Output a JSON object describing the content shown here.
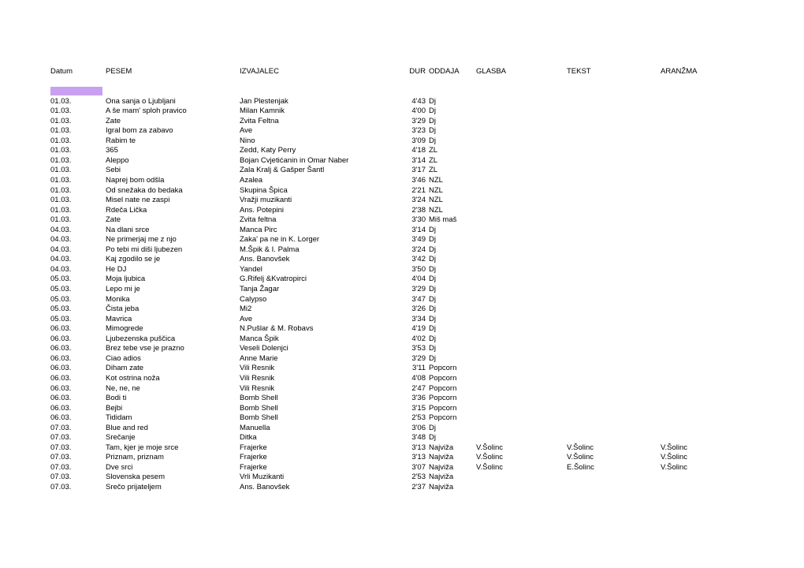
{
  "document": {
    "type": "spreadsheet-playlist-log",
    "highlight_color": "#c9a0f0"
  },
  "table": {
    "headers": {
      "datum": "Datum",
      "pesem": "PESEM",
      "izvajalec": "IZVAJALEC",
      "dur": "DUR",
      "oddaja": "ODDAJA",
      "glasba": "GLASBA",
      "tekst": "TEKST",
      "aranzma": "ARANŽMA"
    },
    "rows": [
      {
        "datum": "01.03.",
        "pesem": "Ona sanja o Ljubljani",
        "izvajalec": "Jan Plestenjak",
        "dur": "4'43",
        "oddaja": "Dj",
        "glasba": "",
        "tekst": "",
        "aranzma": ""
      },
      {
        "datum": "01.03.",
        "pesem": "A še mam' sploh pravico",
        "izvajalec": "Milan Kamnik",
        "dur": "4'00",
        "oddaja": "Dj",
        "glasba": "",
        "tekst": "",
        "aranzma": ""
      },
      {
        "datum": "01.03.",
        "pesem": "Zate",
        "izvajalec": "Zvita Feltna",
        "dur": "3'29",
        "oddaja": "Dj",
        "glasba": "",
        "tekst": "",
        "aranzma": ""
      },
      {
        "datum": "01.03.",
        "pesem": "Igral bom za zabavo",
        "izvajalec": "Ave",
        "dur": "3'23",
        "oddaja": "Dj",
        "glasba": "",
        "tekst": "",
        "aranzma": ""
      },
      {
        "datum": "01.03.",
        "pesem": "Rabim te",
        "izvajalec": "Nino",
        "dur": "3'09",
        "oddaja": "Dj",
        "glasba": "",
        "tekst": "",
        "aranzma": ""
      },
      {
        "datum": "01.03.",
        "pesem": "365",
        "izvajalec": "Zedd, Katy Perry",
        "dur": "4'18",
        "oddaja": "ZL",
        "glasba": "",
        "tekst": "",
        "aranzma": ""
      },
      {
        "datum": "01.03.",
        "pesem": "Aleppo",
        "izvajalec": "Bojan Cvjetićanin in Omar Naber",
        "dur": "3'14",
        "oddaja": "ZL",
        "glasba": "",
        "tekst": "",
        "aranzma": ""
      },
      {
        "datum": "01.03.",
        "pesem": "Sebi",
        "izvajalec": "Zala Kralj & Gašper Šantl",
        "dur": "3'17",
        "oddaja": "ZL",
        "glasba": "",
        "tekst": "",
        "aranzma": ""
      },
      {
        "datum": "01.03.",
        "pesem": "Naprej bom odšla",
        "izvajalec": "Azalea",
        "dur": "3'46",
        "oddaja": "NZL",
        "glasba": "",
        "tekst": "",
        "aranzma": ""
      },
      {
        "datum": "01.03.",
        "pesem": "Od snežaka do bedaka",
        "izvajalec": "Skupina Špica",
        "dur": "2'21",
        "oddaja": "NZL",
        "glasba": "",
        "tekst": "",
        "aranzma": ""
      },
      {
        "datum": "01.03.",
        "pesem": "Misel nate ne zaspi",
        "izvajalec": "Vražji muzikanti",
        "dur": "3'24",
        "oddaja": "NZL",
        "glasba": "",
        "tekst": "",
        "aranzma": ""
      },
      {
        "datum": "01.03.",
        "pesem": "Rdeča Lička",
        "izvajalec": "Ans. Potepini",
        "dur": "2'38",
        "oddaja": "NZL",
        "glasba": "",
        "tekst": "",
        "aranzma": ""
      },
      {
        "datum": "01.03.",
        "pesem": "Zate",
        "izvajalec": "Zvita feltna",
        "dur": "3'30",
        "oddaja": "Miš maš",
        "glasba": "",
        "tekst": "",
        "aranzma": ""
      },
      {
        "datum": "04.03.",
        "pesem": "Na dlani srce",
        "izvajalec": "Manca Pirc",
        "dur": "3'14",
        "oddaja": "Dj",
        "glasba": "",
        "tekst": "",
        "aranzma": ""
      },
      {
        "datum": "04.03.",
        "pesem": "Ne primerjaj me z njo",
        "izvajalec": "Zaka' pa ne in K. Lorger",
        "dur": "3'49",
        "oddaja": "Dj",
        "glasba": "",
        "tekst": "",
        "aranzma": ""
      },
      {
        "datum": "04.03.",
        "pesem": "Po tebi mi diši ljubezen",
        "izvajalec": "M.Špik & I. Palma",
        "dur": "3'24",
        "oddaja": "Dj",
        "glasba": "",
        "tekst": "",
        "aranzma": ""
      },
      {
        "datum": "04.03.",
        "pesem": "Kaj zgodilo se je",
        "izvajalec": "Ans. Banovšek",
        "dur": "3'42",
        "oddaja": "Dj",
        "glasba": "",
        "tekst": "",
        "aranzma": ""
      },
      {
        "datum": "04.03.",
        "pesem": "He DJ",
        "izvajalec": "Yandel",
        "dur": "3'50",
        "oddaja": "Dj",
        "glasba": "",
        "tekst": "",
        "aranzma": ""
      },
      {
        "datum": "05.03.",
        "pesem": "Moja ljubica",
        "izvajalec": "G.Rifelj &Kvatropirci",
        "dur": "4'04",
        "oddaja": "Dj",
        "glasba": "",
        "tekst": "",
        "aranzma": ""
      },
      {
        "datum": "05.03.",
        "pesem": "Lepo mi je",
        "izvajalec": "Tanja Žagar",
        "dur": "3'29",
        "oddaja": "Dj",
        "glasba": "",
        "tekst": "",
        "aranzma": ""
      },
      {
        "datum": "05.03.",
        "pesem": "Monika",
        "izvajalec": "Calypso",
        "dur": "3'47",
        "oddaja": "Dj",
        "glasba": "",
        "tekst": "",
        "aranzma": ""
      },
      {
        "datum": "05.03.",
        "pesem": "Čista jeba",
        "izvajalec": "Mi2",
        "dur": "3'26",
        "oddaja": "Dj",
        "glasba": "",
        "tekst": "",
        "aranzma": ""
      },
      {
        "datum": "05.03.",
        "pesem": "Mavrica",
        "izvajalec": "Ave",
        "dur": "3'34",
        "oddaja": "Dj",
        "glasba": "",
        "tekst": "",
        "aranzma": ""
      },
      {
        "datum": "06.03.",
        "pesem": "Mimogrede",
        "izvajalec": "N.Pušlar & M. Robavs",
        "dur": "4'19",
        "oddaja": "Dj",
        "glasba": "",
        "tekst": "",
        "aranzma": ""
      },
      {
        "datum": "06.03.",
        "pesem": "Ljubezenska puščica",
        "izvajalec": "Manca Špik",
        "dur": "4'02",
        "oddaja": "Dj",
        "glasba": "",
        "tekst": "",
        "aranzma": ""
      },
      {
        "datum": "06.03.",
        "pesem": "Brez tebe vse je prazno",
        "izvajalec": "Veseli Dolenjci",
        "dur": "3'53",
        "oddaja": "Dj",
        "glasba": "",
        "tekst": "",
        "aranzma": ""
      },
      {
        "datum": "06.03.",
        "pesem": "Ciao adios",
        "izvajalec": "Anne Marie",
        "dur": "3'29",
        "oddaja": "Dj",
        "glasba": "",
        "tekst": "",
        "aranzma": ""
      },
      {
        "datum": "06.03.",
        "pesem": "Diham zate",
        "izvajalec": "Vili Resnik",
        "dur": "3'11",
        "oddaja": "Popcorn",
        "glasba": "",
        "tekst": "",
        "aranzma": ""
      },
      {
        "datum": "06.03.",
        "pesem": "Kot ostrina noža",
        "izvajalec": "Vili Resnik",
        "dur": "4'08",
        "oddaja": "Popcorn",
        "glasba": "",
        "tekst": "",
        "aranzma": ""
      },
      {
        "datum": "06.03.",
        "pesem": "Ne, ne, ne",
        "izvajalec": "Vili Resnik",
        "dur": "2'47",
        "oddaja": "Popcorn",
        "glasba": "",
        "tekst": "",
        "aranzma": ""
      },
      {
        "datum": "06.03.",
        "pesem": "Bodi ti",
        "izvajalec": "Bomb Shell",
        "dur": "3'36",
        "oddaja": "Popcorn",
        "glasba": "",
        "tekst": "",
        "aranzma": ""
      },
      {
        "datum": "06.03.",
        "pesem": "Bejbi",
        "izvajalec": "Bomb Shell",
        "dur": "3'15",
        "oddaja": "Popcorn",
        "glasba": "",
        "tekst": "",
        "aranzma": ""
      },
      {
        "datum": "06.03.",
        "pesem": "Tididam",
        "izvajalec": "Bomb Shell",
        "dur": "2'53",
        "oddaja": "Popcorn",
        "glasba": "",
        "tekst": "",
        "aranzma": ""
      },
      {
        "datum": "07.03.",
        "pesem": "Blue and red",
        "izvajalec": "Manuella",
        "dur": "3'06",
        "oddaja": "Dj",
        "glasba": "",
        "tekst": "",
        "aranzma": ""
      },
      {
        "datum": "07.03.",
        "pesem": "Srečanje",
        "izvajalec": "Ditka",
        "dur": "3'48",
        "oddaja": "Dj",
        "glasba": "",
        "tekst": "",
        "aranzma": ""
      },
      {
        "datum": "07.03.",
        "pesem": "Tam, kjer je moje srce",
        "izvajalec": "Frajerke",
        "dur": "3'13",
        "oddaja": "Najviža",
        "glasba": "V.Šolinc",
        "tekst": "V.Šolinc",
        "aranzma": "V.Šolinc"
      },
      {
        "datum": "07.03.",
        "pesem": "Priznam, priznam",
        "izvajalec": "Frajerke",
        "dur": "3'13",
        "oddaja": "Najviža",
        "glasba": "V.Šolinc",
        "tekst": "V.Šolinc",
        "aranzma": "V.Šolinc"
      },
      {
        "datum": "07.03.",
        "pesem": "Dve srci",
        "izvajalec": "Frajerke",
        "dur": "3'07",
        "oddaja": "Najviža",
        "glasba": "V.Šolinc",
        "tekst": "E.Šolinc",
        "aranzma": "V.Šolinc"
      },
      {
        "datum": "07.03.",
        "pesem": "Slovenska pesem",
        "izvajalec": "Vrli Muzikanti",
        "dur": "2'53",
        "oddaja": "Najviža",
        "glasba": "",
        "tekst": "",
        "aranzma": ""
      },
      {
        "datum": "07.03.",
        "pesem": "Srečo prijateljem",
        "izvajalec": "Ans. Banovšek",
        "dur": "2'37",
        "oddaja": "Najviža",
        "glasba": "",
        "tekst": "",
        "aranzma": ""
      }
    ]
  }
}
